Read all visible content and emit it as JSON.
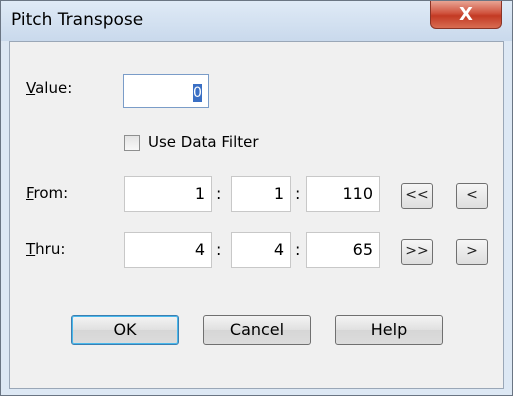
{
  "window": {
    "title": "Pitch Transpose",
    "close_label": "X"
  },
  "value": {
    "label_hotkey": "V",
    "label_rest": "alue:",
    "input": "0"
  },
  "data_filter": {
    "label": "Use Data Filter",
    "checked": false
  },
  "from": {
    "label_hotkey": "F",
    "label_rest": "rom:",
    "fields": [
      "1",
      "1",
      "110"
    ],
    "nav_buttons": [
      "<<",
      "<"
    ]
  },
  "thru": {
    "label_hotkey": "T",
    "label_rest": "hru:",
    "fields": [
      "4",
      "4",
      "65"
    ],
    "nav_buttons": [
      ">>",
      ">"
    ]
  },
  "separator": ":",
  "buttons": {
    "ok": "OK",
    "cancel": "Cancel",
    "help": "Help"
  }
}
